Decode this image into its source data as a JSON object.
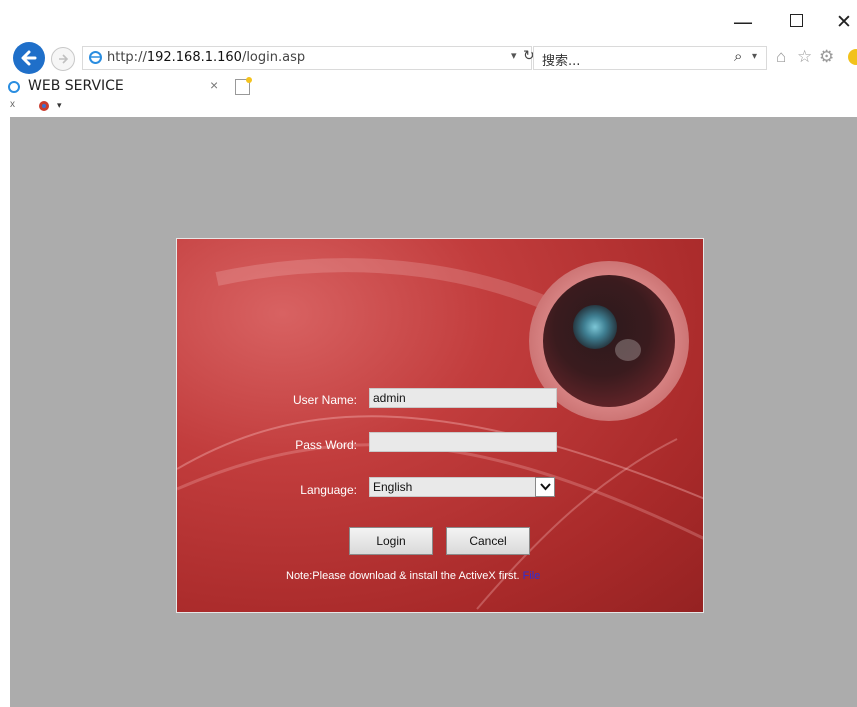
{
  "window": {
    "controls": {
      "minimize": "—",
      "close": "✕"
    }
  },
  "address_bar": {
    "url_prefix": "http://",
    "url_host": "192.168.1.160",
    "url_path": "/login.asp",
    "dropdown": "▾",
    "refresh": "↻"
  },
  "search": {
    "placeholder": "搜索...",
    "icon": "search-icon"
  },
  "tabs": [
    {
      "title": "WEB SERVICE",
      "close": "×"
    }
  ],
  "favorites": {
    "close": "x",
    "arrow": "▾"
  },
  "login": {
    "username_label": "User Name:",
    "username_value": "admin",
    "password_label": "Pass Word:",
    "password_value": "",
    "language_label": "Language:",
    "language_value": "English",
    "login_button": "Login",
    "cancel_button": "Cancel",
    "note": "Note:Please download & install the ActiveX first.",
    "file_link": "File"
  },
  "colors": {
    "panel_red": "#c23d3d",
    "content_gray": "#acacac",
    "link_blue": "#2a2fd8",
    "back_button_blue": "#1f6fc9"
  }
}
